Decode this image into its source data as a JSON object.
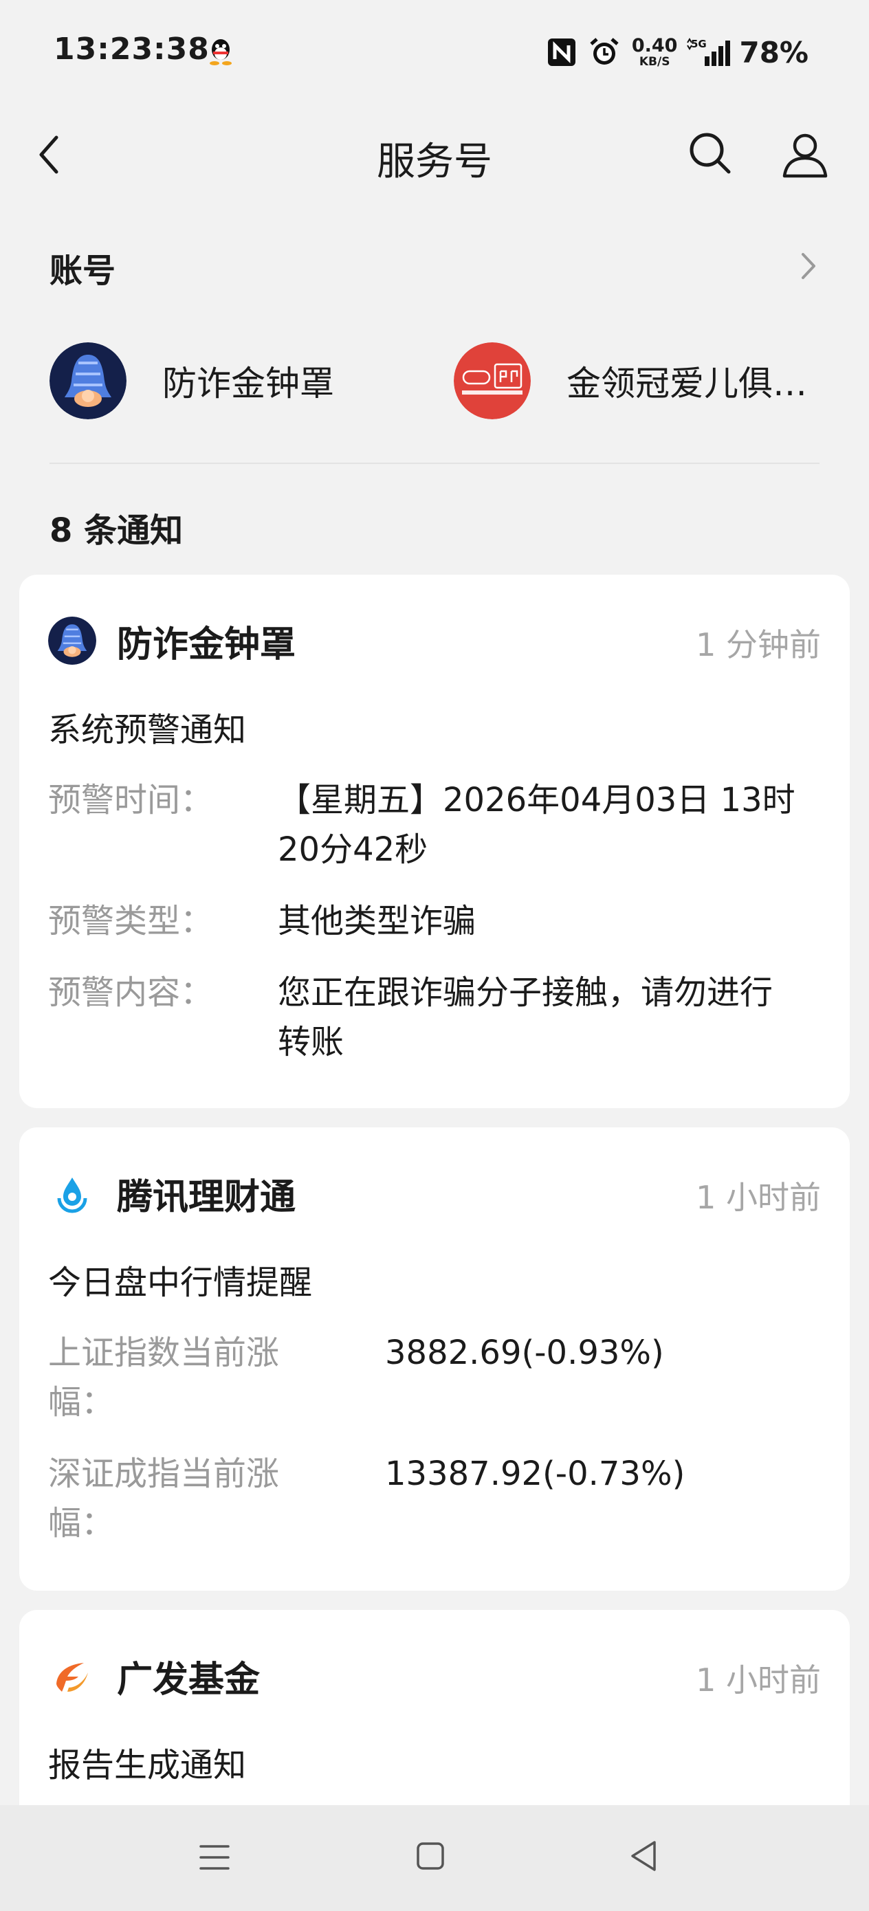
{
  "status_bar": {
    "time": "13:23:38",
    "net_speed": "0.40",
    "net_unit": "KB/S",
    "network": "5G",
    "battery": "78%",
    "icons": [
      "qq-icon",
      "nfc-icon",
      "alarm-icon",
      "signal-icon"
    ]
  },
  "header": {
    "title": "服务号",
    "icons": [
      "back-icon",
      "search-icon",
      "user-icon"
    ]
  },
  "accounts": {
    "section_title": "账号",
    "items": [
      {
        "name": "防诈金钟罩",
        "icon": "bell-shield-avatar"
      },
      {
        "name": "金领冠爱儿俱…",
        "icon": "jinlingguan-club-avatar"
      }
    ]
  },
  "notifications": {
    "count_label": "8 条通知",
    "cards": [
      {
        "source": "防诈金钟罩",
        "time": "1 分钟前",
        "subject": "系统预警通知",
        "fields": [
          {
            "label": "预警时间：",
            "value_line1": "【星期五】2026年04月03日 13时",
            "value_line2": "20分42秒"
          },
          {
            "label": "预警类型：",
            "value_line1": "其他类型诈骗"
          },
          {
            "label": "预警内容：",
            "value_line1": "您正在跟诈骗分子接触，请勿进行",
            "value_line2": "转账"
          }
        ]
      },
      {
        "source": "腾讯理财通",
        "time": "1 小时前",
        "subject": "今日盘中行情提醒",
        "fields": [
          {
            "label_line1": "上证指数当前涨",
            "label_line2": "幅：",
            "value_line1": "3882.69(-0.93%)"
          },
          {
            "label_line1": "深证成指当前涨",
            "label_line2": "幅：",
            "value_line1": "13387.92(-0.73%)"
          }
        ]
      },
      {
        "source": "广发基金",
        "time": "1 小时前",
        "subject": "报告生成通知"
      }
    ]
  },
  "colors": {
    "background": "#f2f2f2",
    "card": "#ffffff",
    "muted_text": "#a6a6a6",
    "label_text": "#9a9a9a",
    "avatar_red": "#e0423a",
    "avatar_navy": "#14204a",
    "licaitong_blue": "#1aa1e6",
    "gf_orange": "#f06a28"
  }
}
